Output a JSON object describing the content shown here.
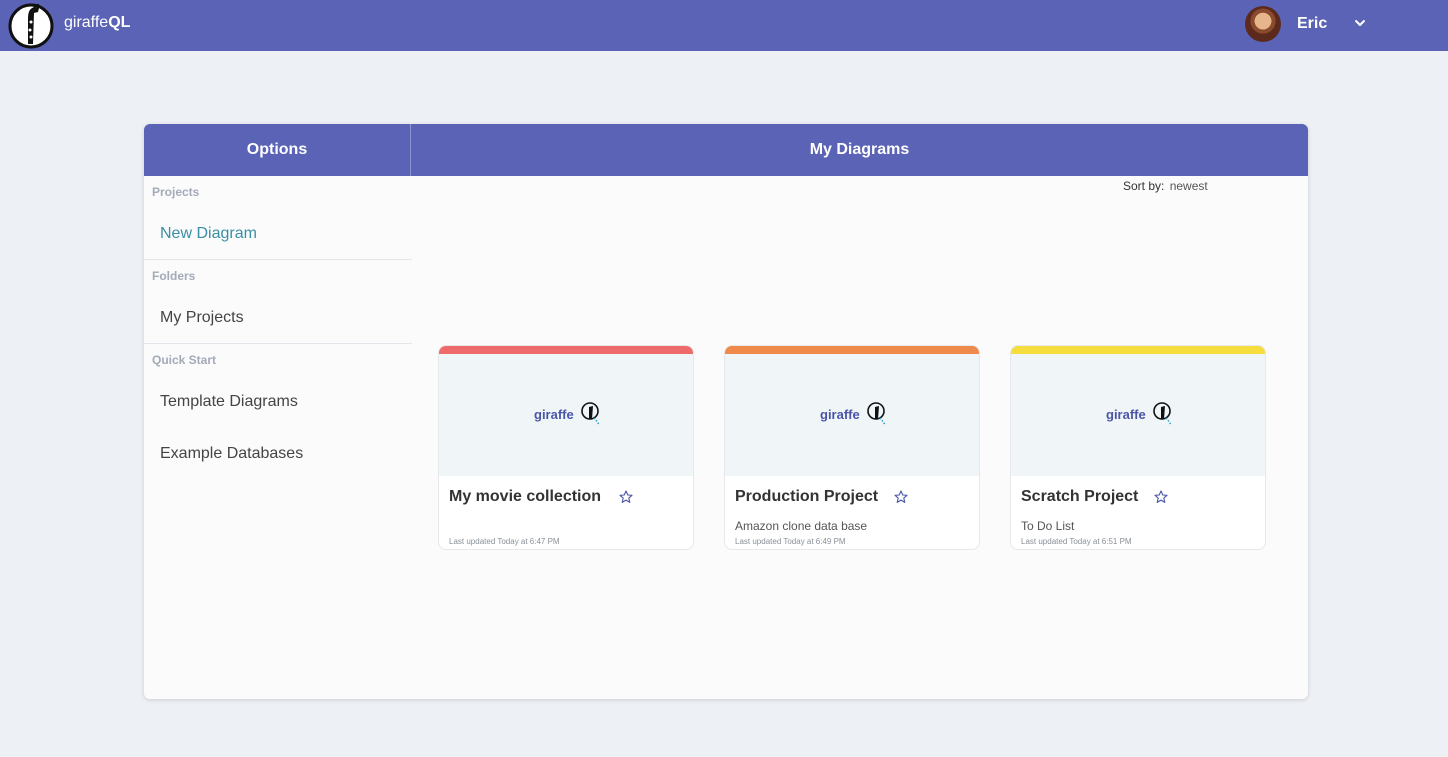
{
  "header": {
    "brand_prefix": "giraffe",
    "brand_suffix": "QL",
    "user_name": "Eric",
    "bar_color": "#5a63b5"
  },
  "panel": {
    "options_title": "Options",
    "diagrams_title": "My Diagrams",
    "sort_label": "Sort by:",
    "sort_value": "newest"
  },
  "sidebar": {
    "sections": [
      {
        "label": "Projects",
        "items": [
          {
            "label": "New Diagram"
          }
        ]
      },
      {
        "label": "Folders",
        "items": [
          {
            "label": "My Projects"
          }
        ]
      },
      {
        "label": "Quick Start",
        "items": [
          {
            "label": "Template Diagrams"
          },
          {
            "label": "Example Databases"
          }
        ]
      }
    ]
  },
  "cards": [
    {
      "title": "My movie collection",
      "description": "",
      "updated": "Last updated Today at 6:47 PM",
      "color": "#ef6b6b",
      "thumb_text": "giraffe"
    },
    {
      "title": "Production Project",
      "description": "Amazon clone data base",
      "updated": "Last updated Today at 6:49 PM",
      "color": "#f08a4b",
      "thumb_text": "giraffe"
    },
    {
      "title": "Scratch Project",
      "description": "To Do List",
      "updated": "Last updated Today at 6:51 PM",
      "color": "#f5dd3d",
      "thumb_text": "giraffe"
    }
  ],
  "icons": {
    "logo": "giraffe-logo-icon",
    "chevron": "chevron-down-icon",
    "star": "star-outline-icon"
  }
}
